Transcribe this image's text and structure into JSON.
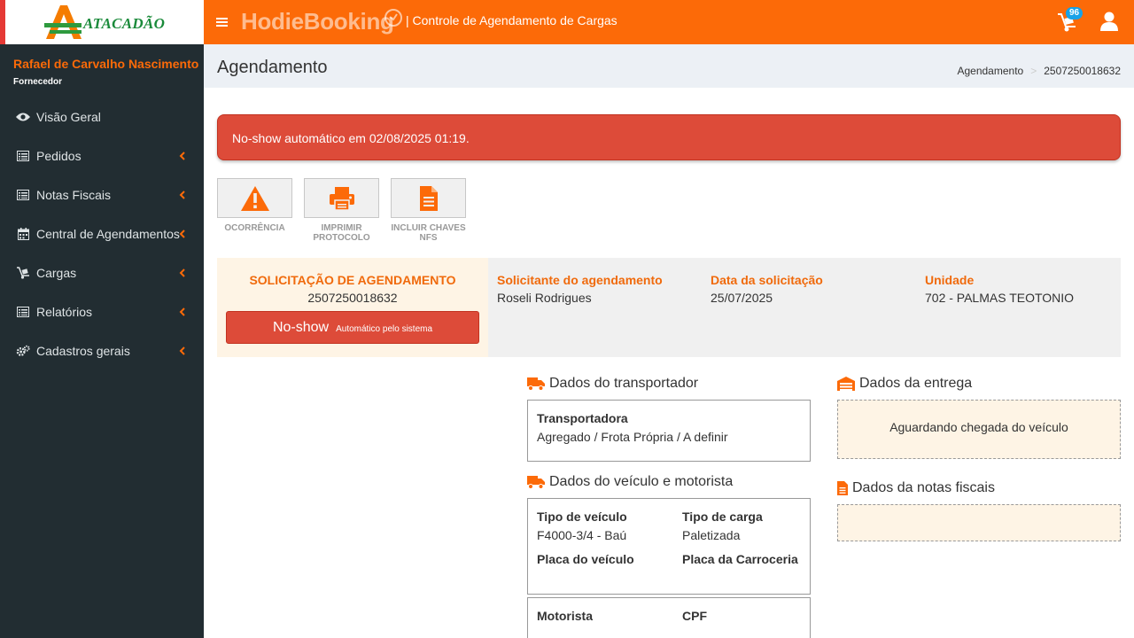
{
  "brand": {
    "logo_text": "ATACADÃO",
    "app_name": "HodieBooking",
    "subtitle": "| Controle de Agendamento de Cargas"
  },
  "header": {
    "cart_badge": "96"
  },
  "user": {
    "name": "Rafael de Carvalho Nascimento",
    "role": "Fornecedor"
  },
  "sidebar": {
    "items": [
      {
        "label": "Visão Geral",
        "icon": "eye-icon"
      },
      {
        "label": "Pedidos",
        "icon": "list-icon"
      },
      {
        "label": "Notas Fiscais",
        "icon": "list-icon"
      },
      {
        "label": "Central de Agendamentos",
        "icon": "calendar-icon"
      },
      {
        "label": "Cargas",
        "icon": "dolly-icon"
      },
      {
        "label": "Relatórios",
        "icon": "list-icon"
      },
      {
        "label": "Cadastros gerais",
        "icon": "gears-icon"
      }
    ]
  },
  "page": {
    "title": "Agendamento",
    "breadcrumb": [
      "Agendamento",
      "2507250018632"
    ]
  },
  "alert": {
    "text": "No-show automático em 02/08/2025 01:19."
  },
  "actions": [
    {
      "label": "OCORRÊNCIA",
      "icon": "warning-icon"
    },
    {
      "label": "IMPRIMIR PROTOCOLO",
      "icon": "print-icon"
    },
    {
      "label": "INCLUIR CHAVES NFS",
      "icon": "file-icon"
    }
  ],
  "request": {
    "title": "SOLICITAÇÃO DE AGENDAMENTO",
    "number": "2507250018632",
    "status": "No-show",
    "status_detail": "Automático pelo sistema",
    "requester_label": "Solicitante do agendamento",
    "requester": "Roseli Rodrigues",
    "date_label": "Data da solicitação",
    "date": "25/07/2025",
    "unit_label": "Unidade",
    "unit": "702 - PALMAS TEOTONIO"
  },
  "carrier": {
    "title": "Dados do transportador",
    "label": "Transportadora",
    "value": "Agregado / Frota Própria / A definir"
  },
  "vehicle": {
    "title": "Dados do veículo e motorista",
    "type_label": "Tipo de veículo",
    "type": "F4000-3/4 - Baú",
    "cargo_label": "Tipo de carga",
    "cargo": "Paletizada",
    "plate_label": "Placa do veículo",
    "plate": "",
    "body_plate_label": "Placa da Carroceria",
    "body_plate": "",
    "driver_label": "Motorista",
    "cpf_label": "CPF"
  },
  "delivery": {
    "title": "Dados da entrega",
    "message": "Aguardando chegada do veículo"
  },
  "invoices": {
    "title": "Dados da notas fiscais"
  },
  "colors": {
    "primary": "#fc6a08",
    "sidebar": "#222d32",
    "danger": "#dd4b39",
    "panel_light": "#fef4e5"
  }
}
